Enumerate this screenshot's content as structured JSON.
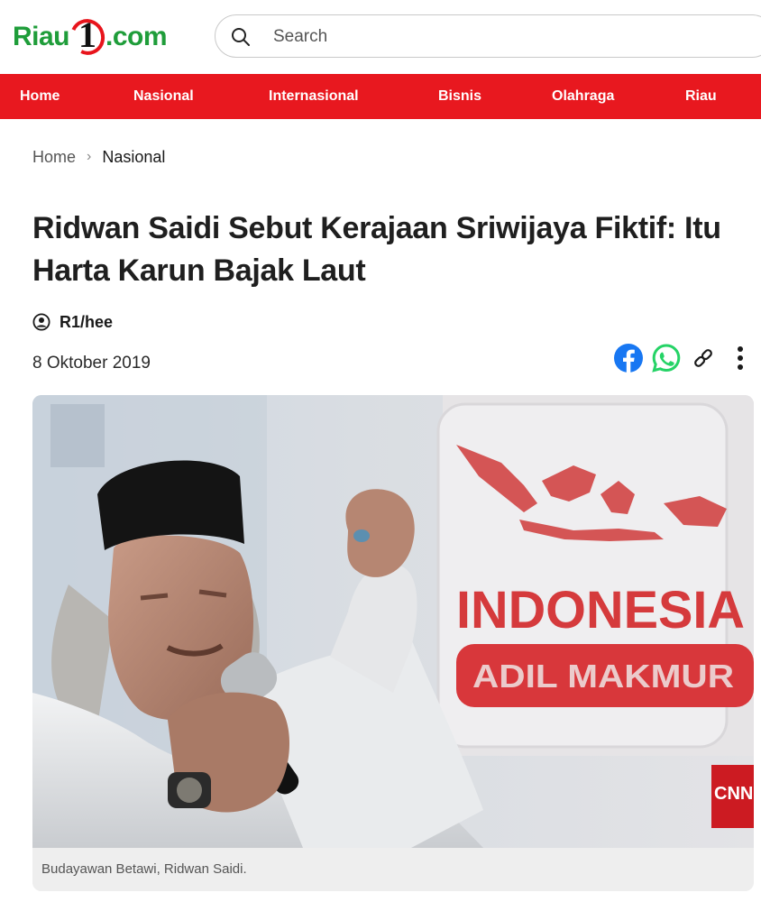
{
  "header": {
    "logo": {
      "left": "Riau",
      "number": "1",
      "right": ".com"
    },
    "search": {
      "placeholder": "Search",
      "icon": "search-icon"
    }
  },
  "nav": {
    "items": [
      {
        "label": "Home"
      },
      {
        "label": "Nasional"
      },
      {
        "label": "Internasional"
      },
      {
        "label": "Bisnis"
      },
      {
        "label": "Olahraga"
      },
      {
        "label": "Riau"
      }
    ],
    "color": "#e8181f"
  },
  "breadcrumb": {
    "home": "Home",
    "separator": "›",
    "current": "Nasional"
  },
  "article": {
    "title": "Ridwan Saidi Sebut Kerajaan Sriwijaya Fiktif: Itu Harta Karun Bajak Laut",
    "author": "R1/hee",
    "date": "8 Oktober 2019",
    "share_icons": [
      "facebook-icon",
      "whatsapp-icon",
      "link-icon",
      "more-vertical-icon"
    ],
    "image": {
      "banner_text": "INDONESIA",
      "banner_subtext": "ADIL MAKMUR",
      "watermark": "CNN",
      "caption": "Budayawan Betawi, Ridwan Saidi."
    }
  },
  "colors": {
    "brand_green": "#1f9d3a",
    "brand_red": "#e8181f",
    "facebook": "#1877f2",
    "whatsapp": "#25d366"
  }
}
